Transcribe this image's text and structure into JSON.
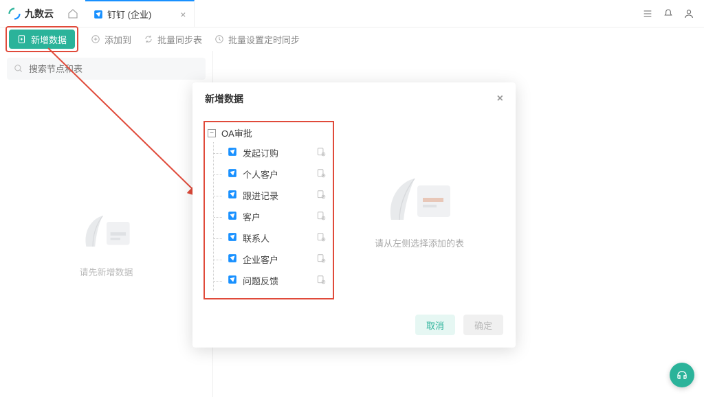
{
  "brand": {
    "name": "九数云"
  },
  "tab": {
    "title": "钉钉 (企业)"
  },
  "toolbar": {
    "new_data": "新增数据",
    "add_to": "添加到",
    "batch_sync": "批量同步表",
    "batch_timed": "批量设置定时同步"
  },
  "search": {
    "placeholder": "搜索节点和表"
  },
  "sidebar_empty": "请先新增数据",
  "dialog": {
    "title": "新增数据",
    "tree_root": "OA审批",
    "items": [
      {
        "label": "发起订购"
      },
      {
        "label": "个人客户"
      },
      {
        "label": "跟进记录"
      },
      {
        "label": "客户"
      },
      {
        "label": "联系人"
      },
      {
        "label": "企业客户"
      },
      {
        "label": "问题反馈"
      }
    ],
    "right_hint": "请从左侧选择添加的表",
    "cancel": "取消",
    "ok": "确定"
  }
}
